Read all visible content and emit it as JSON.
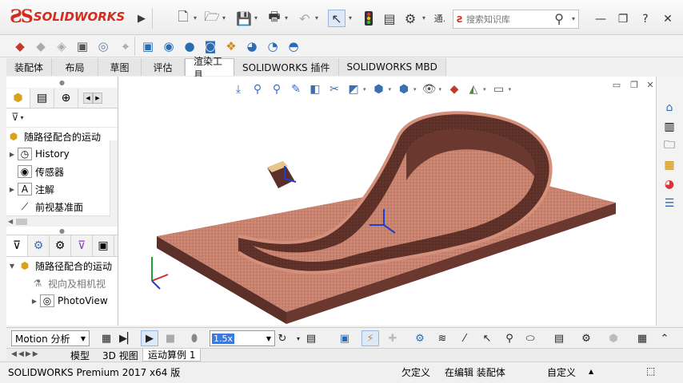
{
  "app": {
    "logo_mark": "ƧS",
    "logo_text": "SOLIDWORKS",
    "search_placeholder": "搜索知识库",
    "truncated_menu": "通."
  },
  "tabs": [
    "装配体",
    "布局",
    "草图",
    "评估",
    "渲染工具",
    "SOLIDWORKS 插件",
    "SOLIDWORKS MBD"
  ],
  "active_tab": "渲染工具",
  "feature_tree": {
    "root_label": "随路径配合的运动",
    "items": [
      {
        "label": "History",
        "icon": "history-icon"
      },
      {
        "label": "传感器",
        "icon": "sensor-icon"
      },
      {
        "label": "注解",
        "icon": "annotation-icon"
      },
      {
        "label": "前视基准面",
        "icon": "plane-icon"
      }
    ]
  },
  "motion_tree": {
    "root_label": "随路径配合的运动",
    "items": [
      {
        "label": "视向及相机视",
        "icon": "camera-icon"
      },
      {
        "label": "PhotoView",
        "icon": "photoview-icon"
      }
    ]
  },
  "motion_bar": {
    "study_type": "Motion 分析",
    "playback_speed": "1.5x"
  },
  "doc_tabs": [
    "模型",
    "3D 视图",
    "运动算例 1"
  ],
  "active_doc_tab": "运动算例 1",
  "status_bar": {
    "product": "SOLIDWORKS Premium 2017 x64 版",
    "definition": "欠定义",
    "editing": "在编辑 装配体",
    "units": "自定义"
  },
  "colors": {
    "brand": "#d52b1e",
    "model_body": "#c9836f",
    "model_dark": "#5b3028",
    "triad_blue": "#1d3fd0"
  }
}
